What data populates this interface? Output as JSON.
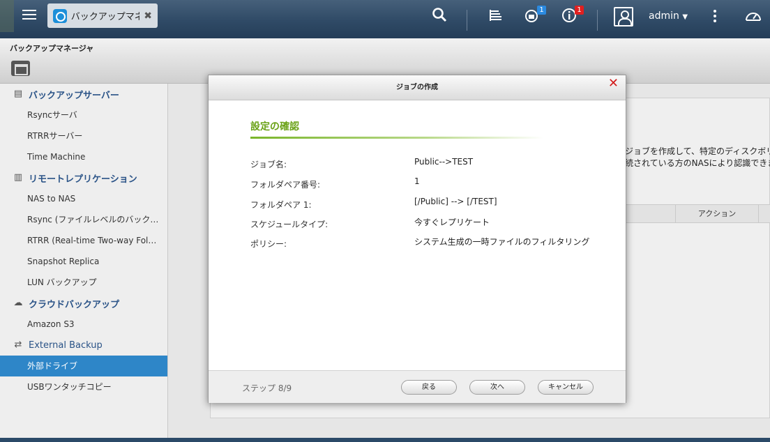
{
  "taskbar": {
    "app_tab_title": "バックアップマネ…",
    "badge_backup": "1",
    "badge_info": "1",
    "user_name": "admin"
  },
  "app": {
    "title": "バックアップマネージャ"
  },
  "sidebar": {
    "groups": [
      {
        "label": "バックアップサーバー",
        "icon": "server-icon"
      },
      {
        "label": "リモートレプリケーション",
        "icon": "replication-icon"
      },
      {
        "label": "クラウドバックアップ",
        "icon": "cloud-icon"
      },
      {
        "label": "External Backup",
        "icon": "sync-icon"
      }
    ],
    "items": [
      "Rsyncサーバ",
      "RTRRサーバー",
      "Time Machine",
      "NAS to NAS",
      "Rsync (ファイルレベルのバックアップ)",
      "RTRR (Real-time Two-way Folder Replication)",
      "Snapshot Replica",
      "LUN バックアップ",
      "Amazon S3",
      "外部ドライブ",
      "USBワンタッチコピー"
    ]
  },
  "main": {
    "bg_text_1": "ジョブを作成して、特定のディスクボリュー",
    "bg_text_2": "続されている方のNASにより認識できます",
    "table_action_header": "アクション"
  },
  "dialog": {
    "title": "ジョブの作成",
    "section_title": "設定の確認",
    "rows": [
      {
        "label": "ジョブ名:",
        "value": "Public-->TEST"
      },
      {
        "label": "フォルダペア番号:",
        "value": "1"
      },
      {
        "label": "フォルダペア 1:",
        "value": "[/Public] --> [/TEST]"
      },
      {
        "label": "スケジュールタイプ:",
        "value": "今すぐレプリケート"
      },
      {
        "label": "ポリシー:",
        "value": "システム生成の一時ファイルのフィルタリング"
      }
    ],
    "step": "ステップ 8/9",
    "buttons": {
      "back": "戻る",
      "next": "次へ",
      "cancel": "キャンセル"
    }
  },
  "colors": {
    "accent_green": "#6aa216",
    "sidebar_active": "#2e86c8",
    "group_label": "#2a5387",
    "close_red": "#d21a1a"
  }
}
